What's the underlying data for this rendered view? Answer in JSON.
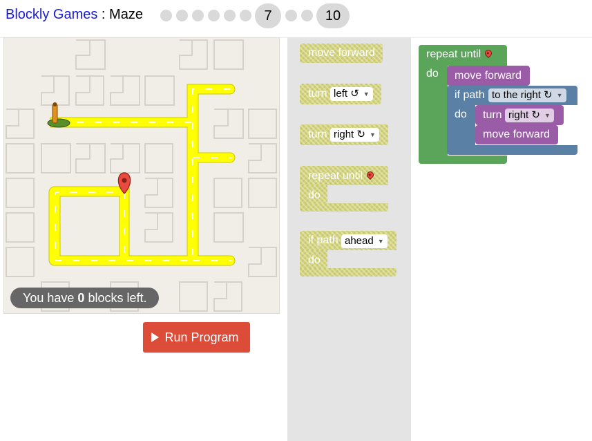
{
  "header": {
    "app_name": "Blockly Games",
    "separator": " : ",
    "game_name": "Maze",
    "current_level": "7",
    "last_level": "10"
  },
  "maze": {
    "blocks_left_prefix": "You have ",
    "blocks_left_count": "0",
    "blocks_left_suffix": " blocks left."
  },
  "run_button": {
    "label": "Run Program"
  },
  "toolbox": {
    "move_forward": "move forward",
    "turn_left": {
      "label": "turn",
      "option": "left ↺"
    },
    "turn_right": {
      "label": "turn",
      "option": "right ↻"
    },
    "repeat_until": {
      "label": "repeat until",
      "do": "do"
    },
    "if_path": {
      "label": "if path",
      "option": "ahead",
      "do": "do"
    }
  },
  "workspace": {
    "repeat_until": {
      "label": "repeat until",
      "do": "do"
    },
    "move_forward_1": "move forward",
    "if_path": {
      "label": "if path",
      "option": "to the right ↻",
      "do": "do"
    },
    "turn": {
      "label": "turn",
      "option": "right ↻"
    },
    "move_forward_2": "move forward"
  },
  "colors": {
    "loop_green": "#5ba55b",
    "action_purple": "#9a5ca6",
    "logic_blue": "#5b80a5",
    "run_red": "#dd4b39",
    "path_yellow": "#ffff00",
    "link_blue": "#1a1ad6"
  }
}
